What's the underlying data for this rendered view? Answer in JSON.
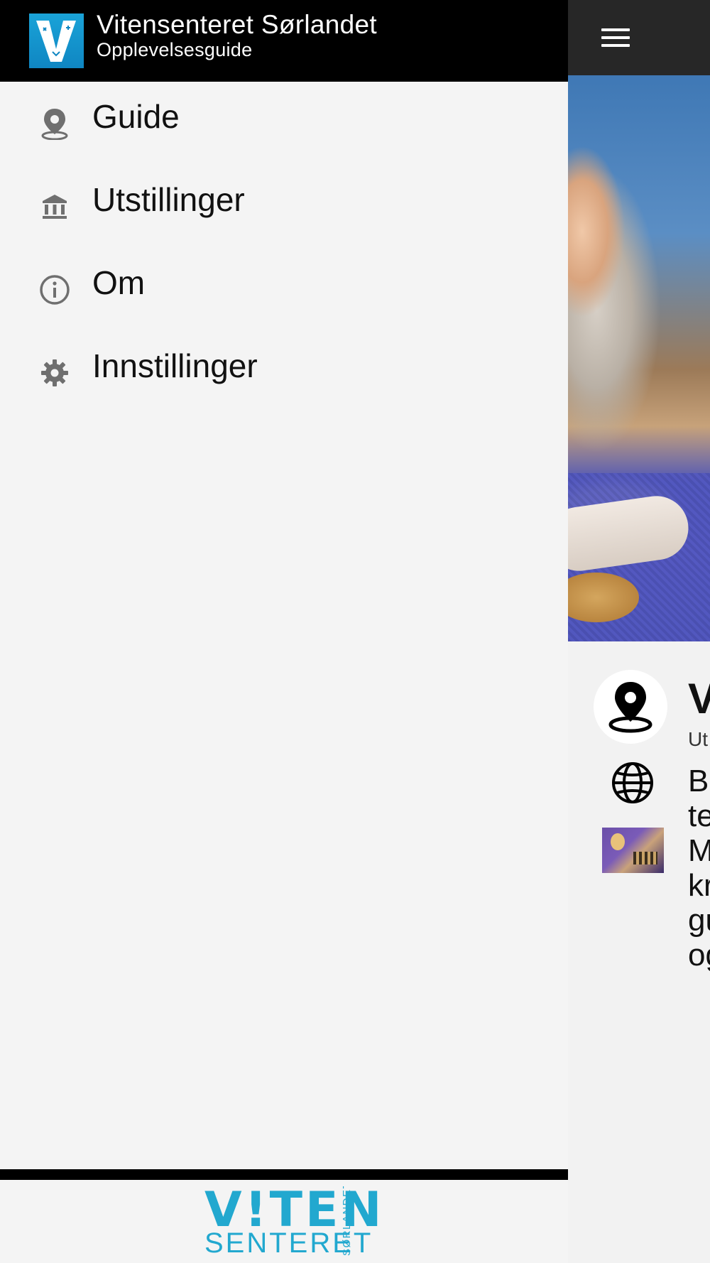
{
  "drawer": {
    "title": "Vitensenteret Sørlandet",
    "subtitle": "Opplevelsesguide",
    "logo_letter": "V",
    "items": [
      {
        "label": "Guide",
        "icon": "map-pin-icon"
      },
      {
        "label": "Utstillinger",
        "icon": "museum-icon"
      },
      {
        "label": "Om",
        "icon": "info-icon"
      },
      {
        "label": "Innstillinger",
        "icon": "gear-icon"
      }
    ],
    "footer_logo": {
      "line1": "V!TEN",
      "line2": "SENTERET",
      "region": "SØRLANDET"
    }
  },
  "background": {
    "title_fragment": "V",
    "subtitle_fragment": "Ut",
    "body_fragments": [
      "Br",
      "te",
      "M",
      "kr",
      "gu",
      "og"
    ]
  },
  "colors": {
    "drawer_header": "#000000",
    "app_header": "#272727",
    "drawer_bg": "#f4f4f4",
    "logo_blue": "#1aa3d8",
    "footer_logo": "#22a8cf",
    "icon_gray": "#6f6f6f"
  }
}
